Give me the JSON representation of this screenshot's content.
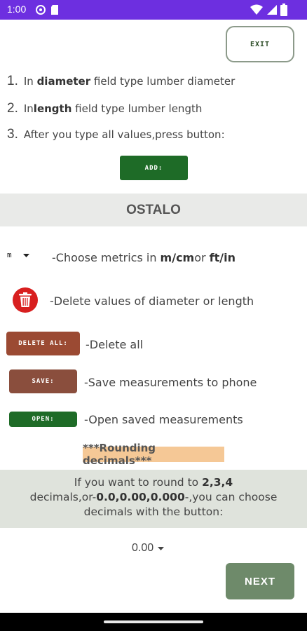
{
  "status_bar": {
    "time": "1:00",
    "bg": "#6d2fe0"
  },
  "exit_label": "EXIT",
  "steps": [
    {
      "num": "1.",
      "pre": "In ",
      "bold": "diameter",
      "post": " field type lumber diameter"
    },
    {
      "num": "2.",
      "pre": "In",
      "bold": "length",
      "post": " field type lumber length"
    },
    {
      "num": "3.",
      "pre": "After you type all values,press button:",
      "bold": "",
      "post": ""
    }
  ],
  "add_label": "ADD:",
  "section_title": "OSTALO",
  "metric_select": "m",
  "metric_desc": {
    "pre": "-Choose metrics in ",
    "bold1": "m/cm",
    "mid": "or ",
    "bold2": "ft/in"
  },
  "delete_desc": "-Delete values of diameter or length",
  "delete_all_label": "DELETE ALL:",
  "delete_all_desc": "-Delete all",
  "save_label": "SAVE:",
  "save_desc": "-Save measurements to phone",
  "open_label": "OPEN:",
  "open_desc": "-Open saved measurements",
  "rounding_title": "***Rounding decimals***",
  "info": {
    "l1_pre": "If you want to round to ",
    "l1_bold": "2,3,4",
    "l2_pre": "decimals,or-",
    "l2_bold": "0.0,0.00,0.000",
    "l2_post": "-,you can choose",
    "l3": "decimals with the button:"
  },
  "decimal_select": "0.00",
  "next_label": "NEXT",
  "colors": {
    "add_green": "#1e6b27",
    "delete_all": "#9b4a33",
    "save": "#8a4e3d",
    "open": "#1e6b27",
    "next": "#6e8a6a",
    "rounding_bg": "#f5c896"
  }
}
